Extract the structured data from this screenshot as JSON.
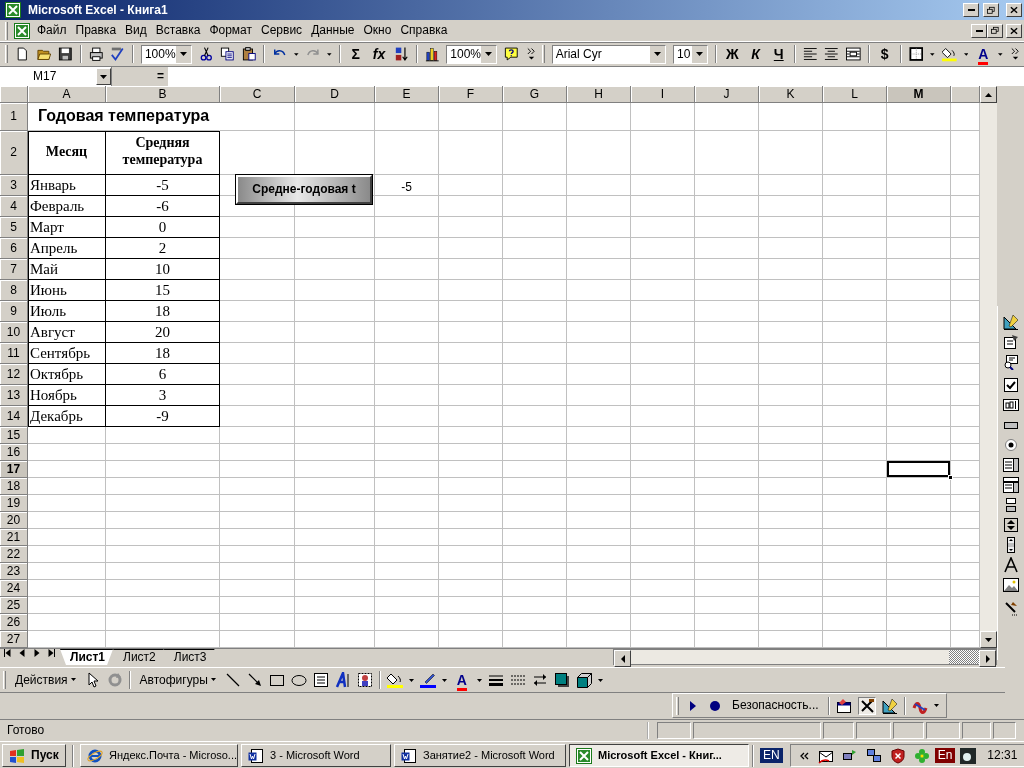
{
  "window": {
    "title": "Microsoft Excel - Книга1"
  },
  "menu": [
    "Файл",
    "Правка",
    "Вид",
    "Вставка",
    "Формат",
    "Сервис",
    "Данные",
    "Окно",
    "Справка"
  ],
  "standard_toolbar": {
    "zoom": "100%",
    "sum": "Σ",
    "function": "fx",
    "chart_zoom": "100%"
  },
  "formatting_toolbar": {
    "font": "Arial Cyr",
    "font_size": "10",
    "bold": "Ж",
    "italic": "К",
    "underline": "Ч",
    "currency": "$",
    "font_color": "A"
  },
  "formula_bar": {
    "name_box": "M17",
    "equals": "="
  },
  "columns": [
    {
      "label": "A",
      "selected": false
    },
    {
      "label": "B",
      "selected": false
    },
    {
      "label": "C",
      "selected": false
    },
    {
      "label": "D",
      "selected": false
    },
    {
      "label": "E",
      "selected": false
    },
    {
      "label": "F",
      "selected": false
    },
    {
      "label": "G",
      "selected": false
    },
    {
      "label": "H",
      "selected": false
    },
    {
      "label": "I",
      "selected": false
    },
    {
      "label": "J",
      "selected": false
    },
    {
      "label": "K",
      "selected": false
    },
    {
      "label": "L",
      "selected": false
    },
    {
      "label": "M",
      "selected": true
    }
  ],
  "rows": [
    {
      "label": "1",
      "kind": "title",
      "selected": false,
      "col_a": "Годовая температура"
    },
    {
      "label": "2",
      "kind": "header",
      "selected": false,
      "col_a": "Месяц",
      "col_b": "Средняя температура"
    },
    {
      "label": "3",
      "kind": "data",
      "selected": false,
      "col_a": "Январь",
      "col_b": "-5",
      "col_e": "-5"
    },
    {
      "label": "4",
      "kind": "data",
      "selected": false,
      "col_a": "Февраль",
      "col_b": "-6"
    },
    {
      "label": "5",
      "kind": "data",
      "selected": false,
      "col_a": "Март",
      "col_b": "0"
    },
    {
      "label": "6",
      "kind": "data",
      "selected": false,
      "col_a": "Апрель",
      "col_b": "2"
    },
    {
      "label": "7",
      "kind": "data",
      "selected": false,
      "col_a": "Май",
      "col_b": "10"
    },
    {
      "label": "8",
      "kind": "data",
      "selected": false,
      "col_a": "Июнь",
      "col_b": "15"
    },
    {
      "label": "9",
      "kind": "data",
      "selected": false,
      "col_a": "Июль",
      "col_b": "18"
    },
    {
      "label": "10",
      "kind": "data",
      "selected": false,
      "col_a": "Август",
      "col_b": "20"
    },
    {
      "label": "11",
      "kind": "data",
      "selected": false,
      "col_a": "Сентябрь",
      "col_b": "18"
    },
    {
      "label": "12",
      "kind": "data",
      "selected": false,
      "col_a": "Октябрь",
      "col_b": "6"
    },
    {
      "label": "13",
      "kind": "data",
      "selected": false,
      "col_a": "Ноябрь",
      "col_b": "3"
    },
    {
      "label": "14",
      "kind": "data",
      "selected": false,
      "col_a": "Декабрь",
      "col_b": "-9"
    },
    {
      "label": "15",
      "kind": "blank",
      "selected": false
    },
    {
      "label": "16",
      "kind": "blank",
      "selected": false
    },
    {
      "label": "17",
      "kind": "blank",
      "selected": true
    },
    {
      "label": "18",
      "kind": "blank",
      "selected": false
    },
    {
      "label": "19",
      "kind": "blank",
      "selected": false
    },
    {
      "label": "20",
      "kind": "blank",
      "selected": false
    },
    {
      "label": "21",
      "kind": "blank",
      "selected": false
    },
    {
      "label": "22",
      "kind": "blank",
      "selected": false
    },
    {
      "label": "23",
      "kind": "blank",
      "selected": false
    },
    {
      "label": "24",
      "kind": "blank",
      "selected": false
    },
    {
      "label": "25",
      "kind": "blank",
      "selected": false
    },
    {
      "label": "26",
      "kind": "blank",
      "selected": false
    },
    {
      "label": "27",
      "kind": "blank",
      "selected": false
    }
  ],
  "macro_button": {
    "label": "Средне-годовая t"
  },
  "sheet_tabs": [
    {
      "label": "Лист1",
      "selected": true
    },
    {
      "label": "Лист2",
      "selected": false
    },
    {
      "label": "Лист3",
      "selected": false
    }
  ],
  "drawing_toolbar": {
    "actions": "Действия",
    "autoshapes": "Автофигуры",
    "font_color": "A"
  },
  "security_toolbar": {
    "label": "Безопасность...",
    "design_mode": true
  },
  "status_bar": {
    "text": "Готово"
  },
  "taskbar": {
    "start": "Пуск",
    "tasks": [
      {
        "label": "Яндекс.Почта - Microso...",
        "selected": false
      },
      {
        "label": "3 - Microsoft Word",
        "selected": false
      },
      {
        "label": "Занятие2 - Microsoft Word",
        "selected": false
      },
      {
        "label": "Microsoft Excel - Книг...",
        "selected": true
      }
    ],
    "language": "EN",
    "tray_language": "En",
    "clock": "12:31"
  }
}
